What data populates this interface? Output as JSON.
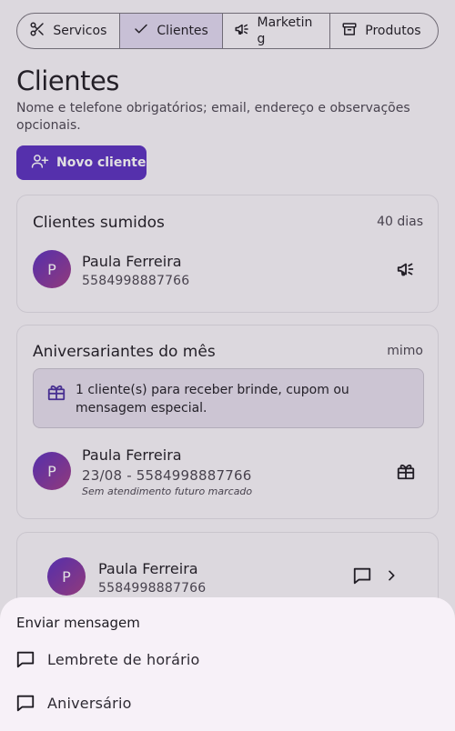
{
  "tabs": [
    {
      "label": "Servicos",
      "icon": "scissors-icon",
      "active": false
    },
    {
      "label": "Clientes",
      "icon": "check-icon",
      "active": true
    },
    {
      "label": "Marketing",
      "icon": "megaphone-icon",
      "active": false
    },
    {
      "label": "Produtos",
      "icon": "archive-icon",
      "active": false
    }
  ],
  "header": {
    "title": "Clientes",
    "subtitle": "Nome e telefone obrigatórios; email, endereço e observações opcionais.",
    "new_button": "Novo cliente"
  },
  "missing_card": {
    "title": "Clientes sumidos",
    "meta": "40 dias",
    "client": {
      "initial": "P",
      "name": "Paula Ferreira",
      "phone": "5584998887766"
    }
  },
  "birthday_card": {
    "title": "Aniversariantes do mês",
    "meta": "mimo",
    "banner": "1 cliente(s) para receber brinde, cupom ou mensagem especial.",
    "client": {
      "initial": "P",
      "name": "Paula Ferreira",
      "detail": "23/08 - 5584998887766",
      "note": "Sem atendimento futuro marcado"
    }
  },
  "list_card": {
    "client": {
      "initial": "P",
      "name": "Paula Ferreira",
      "phone": "5584998887766"
    }
  },
  "sheet": {
    "title": "Enviar mensagem",
    "items": [
      {
        "label": "Lembrete de horário",
        "icon": "message-icon"
      },
      {
        "label": "Aniversário",
        "icon": "message-icon"
      }
    ]
  },
  "colors": {
    "accent": "#5a2fc0",
    "avatar_gradient_end": "#a23a86",
    "active_tab": "#e3dbf2"
  }
}
